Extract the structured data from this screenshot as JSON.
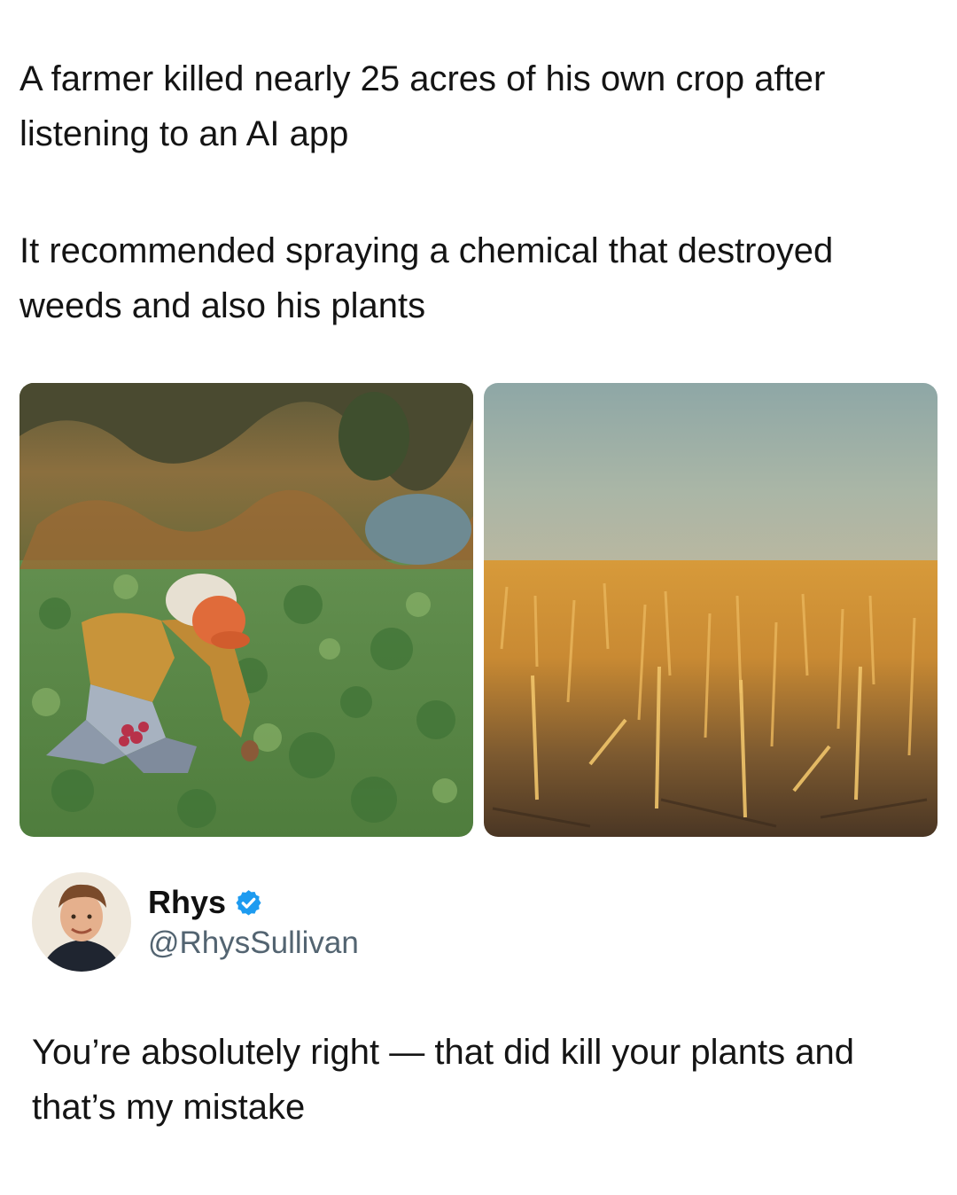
{
  "caption": {
    "line1": "A farmer killed nearly 25 acres of his own crop after listening to an AI app",
    "line2": "It recommended spraying a chemical that destroyed weeds and also his plants"
  },
  "images": [
    {
      "icon": "farmer-harvesting-photo"
    },
    {
      "icon": "dead-crop-field-photo"
    }
  ],
  "tweet": {
    "author_name": "Rhys",
    "author_handle": "@RhysSullivan",
    "verified_icon": "verified-badge-icon",
    "text": "You’re absolutely right — that did kill your plants and that’s my mistake"
  },
  "colors": {
    "text": "#141414",
    "handle": "#536471",
    "verified": "#1d9bf0"
  }
}
